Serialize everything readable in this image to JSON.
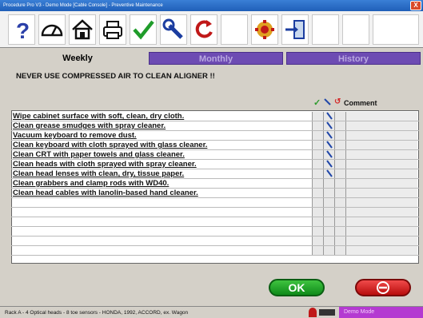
{
  "window": {
    "title": "Procedure Pro V3 - Demo Mode [Cable Console] - Preventive Maintenance",
    "close_label": "X"
  },
  "toolbar": {
    "buttons": [
      {
        "name": "help",
        "icon": "question-mark-icon"
      },
      {
        "name": "gauge",
        "icon": "speedometer-icon"
      },
      {
        "name": "home",
        "icon": "house-icon"
      },
      {
        "name": "print",
        "icon": "printer-icon"
      },
      {
        "name": "approve",
        "icon": "checkmark-icon"
      },
      {
        "name": "tools",
        "icon": "wrench-icon"
      },
      {
        "name": "reset",
        "icon": "undo-arrows-icon"
      },
      {
        "name": "blank1",
        "icon": ""
      },
      {
        "name": "settings",
        "icon": "gear-grid-icon"
      },
      {
        "name": "exit",
        "icon": "exit-door-icon"
      }
    ]
  },
  "tabs": {
    "weekly": "Weekly",
    "monthly": "Monthly",
    "history": "History"
  },
  "warning": "NEVER USE COMPRESSED AIR TO CLEAN ALIGNER !!",
  "columns": {
    "check": "✓",
    "wrench": "🔧",
    "undo": "↺",
    "comment": "Comment"
  },
  "tasks": [
    {
      "text": "Wipe cabinet surface with soft, clean, dry cloth.",
      "wrench": true
    },
    {
      "text": "Clean grease smudges with spray cleaner.",
      "wrench": true
    },
    {
      "text": "Vacuum keyboard to remove dust.",
      "wrench": true
    },
    {
      "text": "Clean keyboard with cloth sprayed with glass cleaner.",
      "wrench": true
    },
    {
      "text": "Clean CRT with paper towels and glass cleaner.",
      "wrench": true
    },
    {
      "text": "Clean heads with cloth sprayed with spray cleaner.",
      "wrench": true
    },
    {
      "text": "Clean head lenses with clean, dry, tissue paper.",
      "wrench": true
    },
    {
      "text": "Clean grabbers and clamp rods with WD40.",
      "wrench": false
    },
    {
      "text": "Clean head cables with lanolin-based hand cleaner.",
      "wrench": false
    },
    {
      "text": "",
      "wrench": false
    },
    {
      "text": "",
      "wrench": false
    },
    {
      "text": "",
      "wrench": false
    },
    {
      "text": "",
      "wrench": false
    },
    {
      "text": "",
      "wrench": false
    },
    {
      "text": "",
      "wrench": false
    }
  ],
  "buttons": {
    "ok": "OK",
    "cancel_icon": "no-entry-icon"
  },
  "status": {
    "text": "Rack A - 4 Optical heads - 8 toe sensors - HONDA, 1992, ACCORD, ex. Wagon",
    "mode": "Demo Mode"
  },
  "colors": {
    "tab_inactive": "#6d4bb3",
    "ok_green": "#17a02a",
    "cancel_red": "#d41c1c",
    "demo_magenta": "#b43ad1"
  }
}
